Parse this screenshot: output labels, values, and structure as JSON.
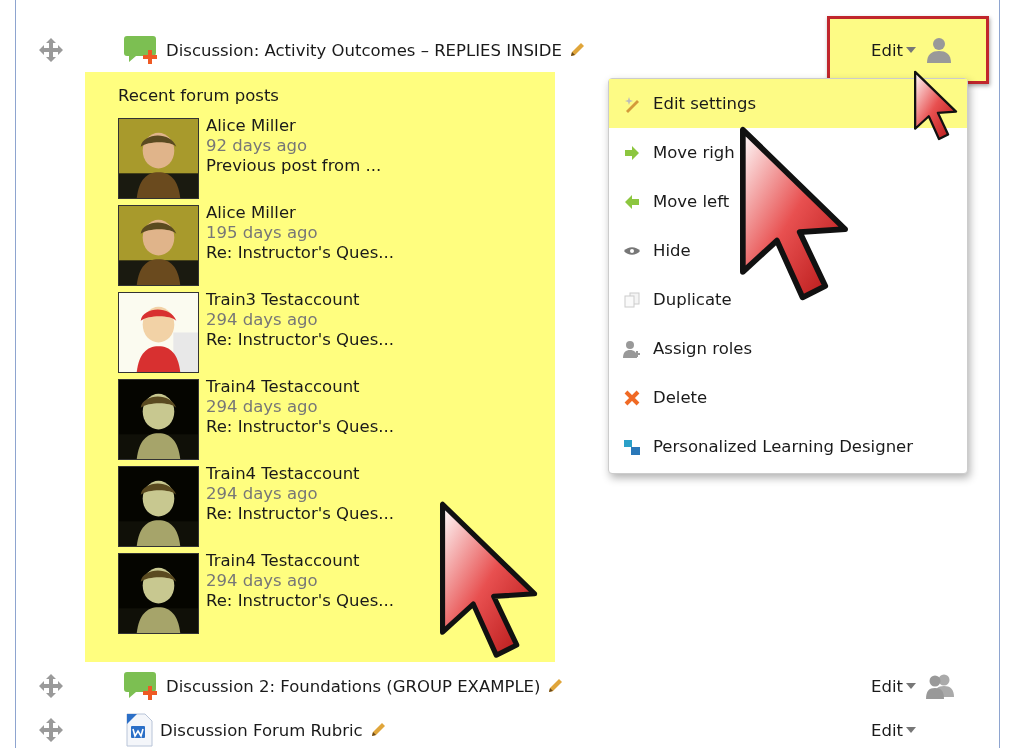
{
  "activities": [
    {
      "kind": "forum",
      "title": "Discussion: Activity Outcomes – REPLIES INSIDE",
      "edit": "Edit",
      "highlighted": true
    },
    {
      "kind": "forum",
      "title": "Discussion 2: Foundations (GROUP EXAMPLE)",
      "edit": "Edit",
      "highlighted": false
    },
    {
      "kind": "document",
      "title": "Discussion Forum Rubric",
      "edit": "Edit",
      "highlighted": false
    }
  ],
  "recent_posts": {
    "title": "Recent forum posts",
    "posts": [
      {
        "name": "Alice Miller",
        "time": "92 days ago",
        "subject": "Previous post from ..."
      },
      {
        "name": "Alice Miller",
        "time": "195 days ago",
        "subject": "Re: Instructor's Ques..."
      },
      {
        "name": "Train3 Testaccount",
        "time": "294 days ago",
        "subject": "Re: Instructor's Ques..."
      },
      {
        "name": "Train4 Testaccount",
        "time": "294 days ago",
        "subject": "Re: Instructor's Ques..."
      },
      {
        "name": "Train4 Testaccount",
        "time": "294 days ago",
        "subject": "Re: Instructor's Ques..."
      },
      {
        "name": "Train4 Testaccount",
        "time": "294 days ago",
        "subject": "Re: Instructor's Ques..."
      }
    ]
  },
  "edit_menu": {
    "items": [
      {
        "label": "Edit settings",
        "selected": true
      },
      {
        "label": "Move righ",
        "selected": false
      },
      {
        "label": "Move left",
        "selected": false
      },
      {
        "label": "Hide",
        "selected": false
      },
      {
        "label": "Duplicate",
        "selected": false
      },
      {
        "label": "Assign roles",
        "selected": false
      },
      {
        "label": "Delete",
        "selected": false
      },
      {
        "label": "Personalized Learning Designer",
        "selected": false
      }
    ]
  }
}
